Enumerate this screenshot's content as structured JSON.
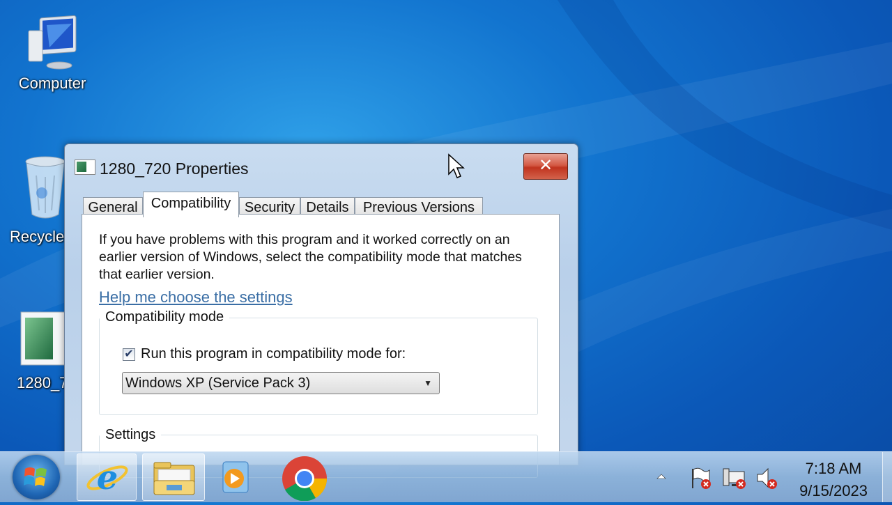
{
  "desktop": {
    "icons": [
      {
        "label": "Computer"
      },
      {
        "label": "Recycle"
      },
      {
        "label": "1280_7"
      }
    ]
  },
  "dialog": {
    "title": "1280_720 Properties",
    "close_label": "✕",
    "tabs": [
      {
        "label": "General"
      },
      {
        "label": "Compatibility",
        "active": true
      },
      {
        "label": "Security"
      },
      {
        "label": "Details"
      },
      {
        "label": "Previous Versions"
      }
    ],
    "description": "If you have problems with this program and it worked correctly on an earlier version of Windows, select the compatibility mode that matches that earlier version.",
    "help_link": "Help me choose the settings",
    "compat_group": {
      "title": "Compatibility mode",
      "checkbox_label": "Run this program in compatibility mode for:",
      "checked": true,
      "selected_mode": "Windows XP (Service Pack 3)"
    },
    "settings_group": {
      "title": "Settings"
    }
  },
  "taskbar": {
    "pinned": [
      "internet-explorer-icon",
      "windows-explorer-icon",
      "media-player-icon",
      "chrome-icon"
    ],
    "tray": [
      "show-hidden-icons",
      "action-center-flag-icon",
      "network-icon",
      "volume-muted-icon"
    ],
    "clock": {
      "time": "7:18 AM",
      "date": "9/15/2023"
    }
  },
  "colors": {
    "desktop_bg": "#1274cf",
    "close_button": "#c0341f",
    "link": "#3a6ea5"
  }
}
